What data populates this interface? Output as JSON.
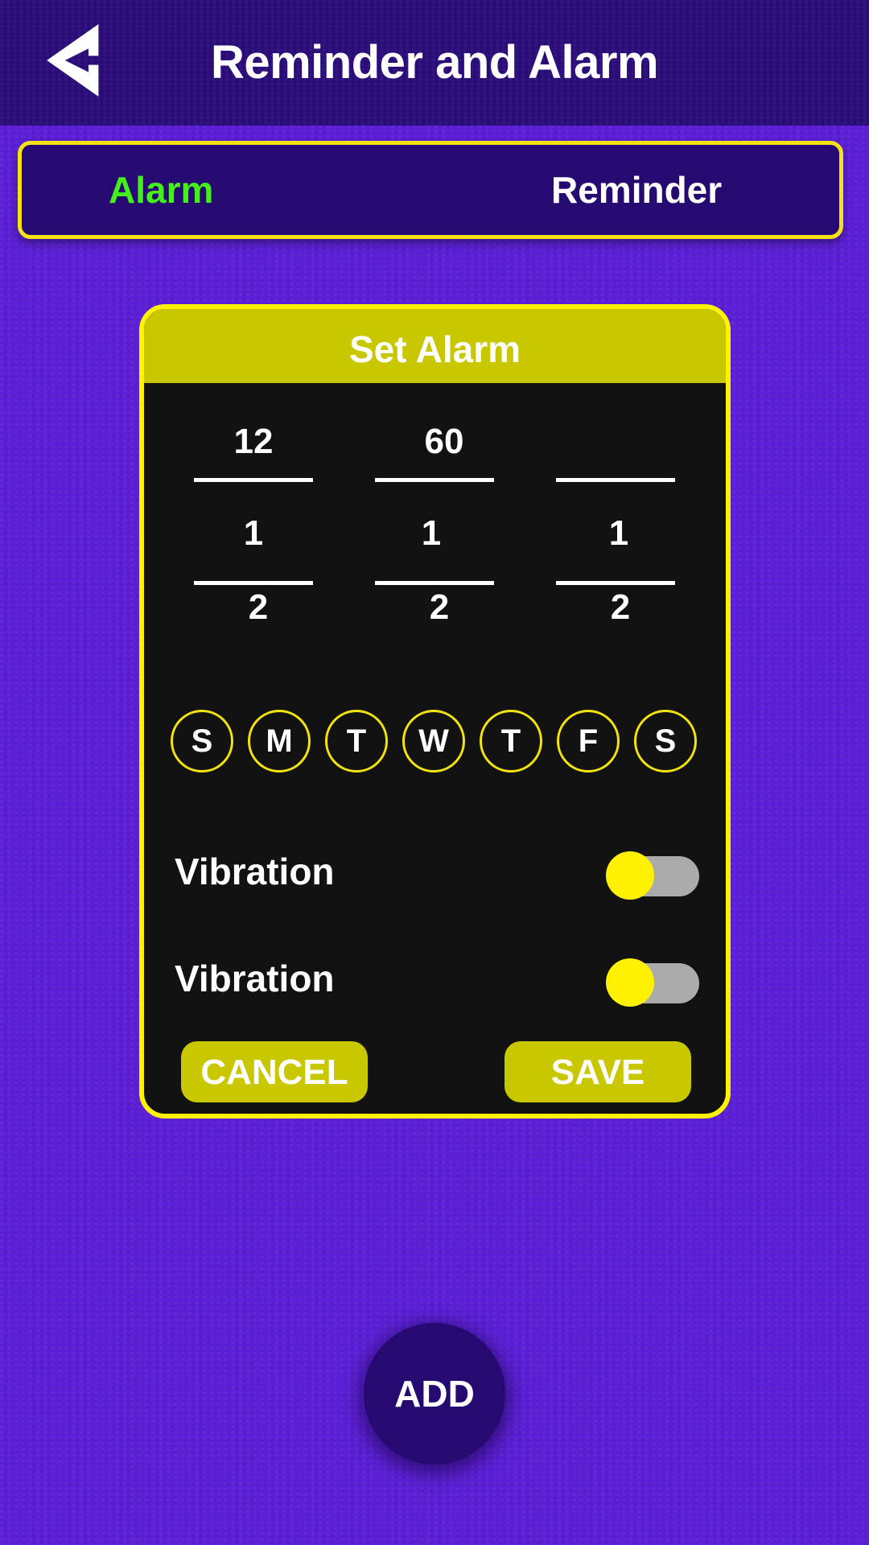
{
  "header": {
    "title": "Reminder and Alarm",
    "back_icon": "back-arrow-icon"
  },
  "tabs": [
    {
      "label": "Alarm",
      "active": true,
      "color": "#44f01a"
    },
    {
      "label": "Reminder",
      "active": false,
      "color": "#ffffff"
    }
  ],
  "dialog": {
    "title": "Set Alarm",
    "columns": [
      {
        "top_value": "12",
        "middle_value": "1",
        "bottom_value": "2"
      },
      {
        "top_value": "60",
        "middle_value": "1",
        "bottom_value": "2"
      },
      {
        "top_value": "",
        "middle_value": "1",
        "bottom_value": "2"
      }
    ],
    "days": [
      "S",
      "M",
      "T",
      "W",
      "T",
      "F",
      "S"
    ],
    "toggles": [
      {
        "label": "Vibration",
        "on": false
      },
      {
        "label": "Vibration",
        "on": false
      }
    ],
    "cancel_label": "CANCEL",
    "save_label": "SAVE"
  },
  "add_label": "ADD",
  "colors": {
    "background": "#5b1fd6",
    "header_bg": "#2a0c78",
    "accent_yellow": "#fff200",
    "dialog_header": "#c9c700",
    "active_tab": "#44f01a"
  }
}
